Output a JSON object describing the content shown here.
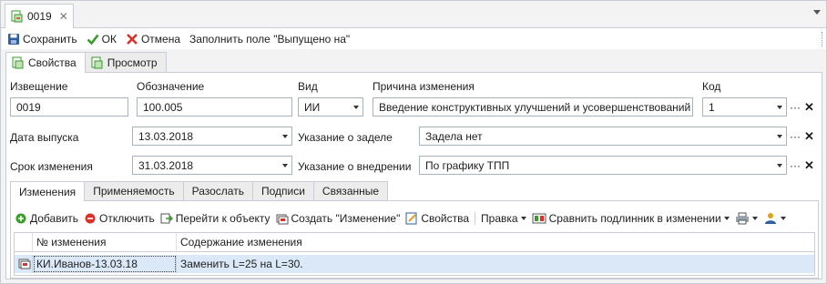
{
  "doc_tab": {
    "title": "0019"
  },
  "toolbar": {
    "save": "Сохранить",
    "ok": "ОК",
    "cancel": "Отмена",
    "fill": "Заполнить поле \"Выпущено на\""
  },
  "tabs_top": [
    {
      "label": "Свойства"
    },
    {
      "label": "Просмотр"
    }
  ],
  "form": {
    "notice_label": "Извещение",
    "notice_value": "0019",
    "designation_label": "Обозначение",
    "designation_value": "100.005",
    "kind_label": "Вид",
    "kind_value": "ИИ",
    "reason_label": "Причина изменения",
    "reason_value": "Введение конструктивных улучшений и усовершенствований",
    "code_label": "Код",
    "code_value": "1",
    "release_label": "Дата выпуска",
    "release_value": "13.03.2018",
    "backlog_label": "Указание о заделе",
    "backlog_value": "Задела нет",
    "deadline_label": "Срок изменения",
    "deadline_value": "31.03.2018",
    "implementation_label": "Указание о внедрении",
    "implementation_value": "По графику ТПП"
  },
  "tabs_bottom": [
    {
      "label": "Изменения"
    },
    {
      "label": "Применяемость"
    },
    {
      "label": "Разослать"
    },
    {
      "label": "Подписи"
    },
    {
      "label": "Связанные"
    }
  ],
  "toolbar2": {
    "add": "Добавить",
    "disable": "Отключить",
    "goto": "Перейти к объекту",
    "create": "Создать \"Изменение\"",
    "props": "Свойства",
    "edit": "Правка",
    "compare": "Сравнить подлинник в изменении"
  },
  "grid": {
    "columns": [
      "№ изменения",
      "Содержание изменения"
    ],
    "rows": [
      {
        "number": "КИ.Иванов-13.03.18",
        "content": "Заменить L=25 на L=30."
      }
    ]
  },
  "colors": {
    "accent_green": "#3a9a2c",
    "cancel_red": "#d9322a",
    "selection": "#dbe8f7"
  }
}
